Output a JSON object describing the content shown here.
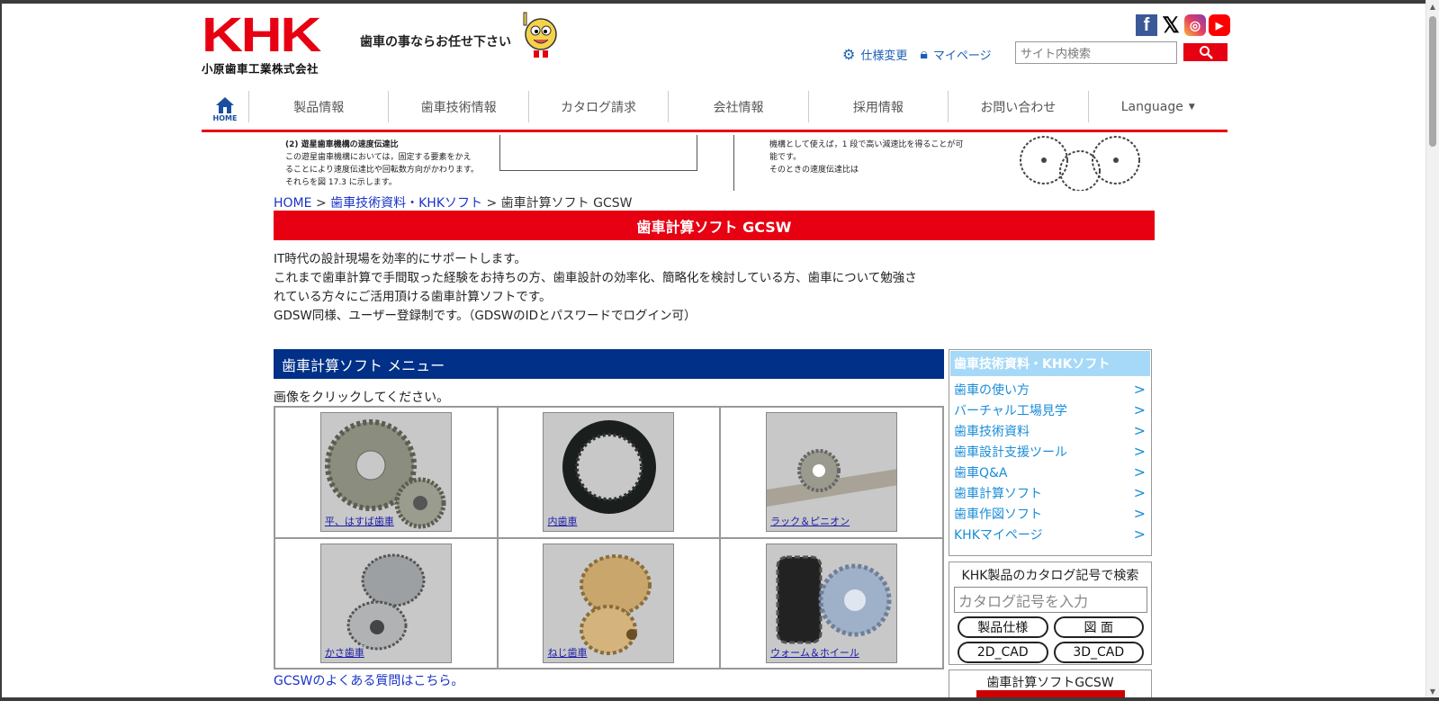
{
  "header": {
    "logo_mark": "KHK",
    "logo_subtitle": "小原歯車工業株式会社",
    "tagline": "歯車の事ならお任せ下さい",
    "social": [
      "facebook-icon",
      "x-icon",
      "instagram-icon",
      "youtube-icon"
    ],
    "spec_change_label": "仕様変更",
    "mypage_label": "マイページ",
    "search_placeholder": "サイト内検索"
  },
  "nav": {
    "home_label": "HOME",
    "items": [
      "製品情報",
      "歯車技術情報",
      "カタログ請求",
      "会社情報",
      "採用情報",
      "お問い合わせ",
      "Language"
    ]
  },
  "banner": {
    "left_lines": [
      "(2) 遊星歯車機構の速度伝達比",
      "この遊星歯車機構においては，固定する要素をかえ",
      "ることにより速度伝達比や回転数方向がかわります。",
      "それらを図 17.3 に示します。"
    ],
    "right_lines": [
      "機構として使えば，1 段で高い減速比を得ることが可",
      "能です。",
      "そのときの速度伝達比は"
    ]
  },
  "breadcrumb": {
    "home": "HOME",
    "sep1": ">",
    "section": "歯車技術資料・KHKソフト",
    "sep2": ">",
    "current": "歯車計算ソフト GCSW"
  },
  "page_title": "歯車計算ソフト GCSW",
  "intro": [
    "IT時代の設計現場を効率的にサポートします。",
    "これまで歯車計算で手間取った経験をお持ちの方、歯車設計の効率化、簡略化を検討している方、歯車について勉強さ",
    "れている方々にご活用頂ける歯車計算ソフトです。",
    "GDSW同様、ユーザー登録制です。（GDSWのIDとパスワードでログイン可）"
  ],
  "menu": {
    "title": "歯車計算ソフト メニュー",
    "note": "画像をクリックしてください。",
    "items": [
      "平、はすば歯車",
      "内歯車",
      "ラック＆ピニオン",
      "かさ歯車",
      "ねじ歯車",
      "ウォーム＆ホイール"
    ],
    "faq_link": "GCSWのよくある質問はこちら。"
  },
  "sidebar": {
    "heading": "歯車技術資料・KHKソフト",
    "items": [
      "歯車の使い方",
      "バーチャル工場見学",
      "歯車技術資料",
      "歯車設計支援ツール",
      "歯車Q&A",
      "歯車計算ソフト",
      "歯車作図ソフト",
      "KHKマイページ"
    ],
    "arrow": ">"
  },
  "catalog_search": {
    "title": "KHK製品のカタログ記号で検索",
    "placeholder": "カタログ記号を入力",
    "buttons": [
      "製品仕様",
      "図 面",
      "2D_CAD",
      "3D_CAD"
    ]
  },
  "gcsw_box": {
    "title": "歯車計算ソフトGCSW"
  },
  "colors": {
    "brand_red": "#e60012",
    "menu_blue": "#003087",
    "sidebar_head": "#a6d9f7",
    "link_blue": "#1a8cd8"
  }
}
